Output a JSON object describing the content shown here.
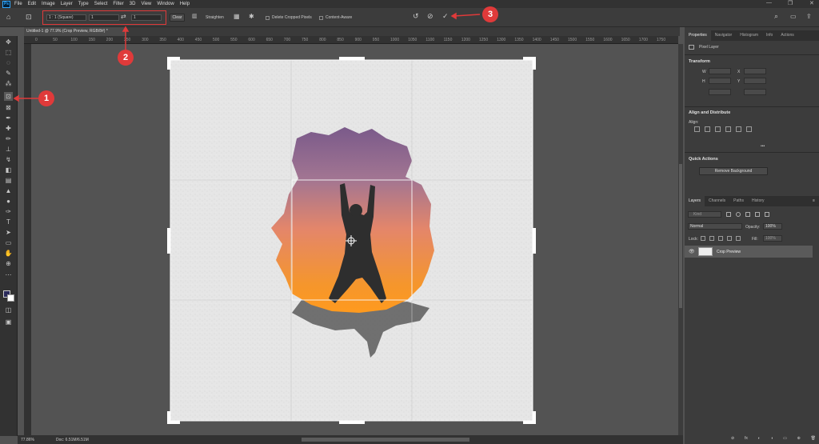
{
  "menubar": {
    "logo": "Ps",
    "items": [
      "File",
      "Edit",
      "Image",
      "Layer",
      "Type",
      "Select",
      "Filter",
      "3D",
      "View",
      "Window",
      "Help"
    ],
    "win_controls": [
      "—",
      "❐",
      "✕"
    ]
  },
  "options": {
    "ratio": "1 : 1 (Square)",
    "width": "1",
    "height": "1",
    "clear_label": "Clear",
    "straighten_label": "Straighten",
    "delete_label": "Delete Cropped Pixels",
    "content_aware_label": "Content-Aware"
  },
  "document": {
    "tab_title": "Untitled-1 @ 77.9% (Crop Preview, RGB/8#) *"
  },
  "ruler": {
    "ticks": [
      "0",
      "50",
      "100",
      "150",
      "200",
      "250",
      "300",
      "350",
      "400",
      "450",
      "500",
      "550",
      "600",
      "650",
      "700",
      "750",
      "800",
      "850",
      "900",
      "950",
      "1000",
      "1050",
      "1100",
      "1150",
      "1200",
      "1250",
      "1300",
      "1350",
      "1400",
      "1450",
      "1500",
      "1550",
      "1600",
      "1650",
      "1700",
      "1750"
    ]
  },
  "status": {
    "zoom": "77.86%",
    "doc": "Doc: 6.51M/6.51M"
  },
  "annotations": [
    "1",
    "2",
    "3"
  ],
  "panels": {
    "top_tabs": [
      "Properties",
      "Navigator",
      "Histogram",
      "Info",
      "Actions"
    ],
    "pixel_layer": "Pixel Layer",
    "transform": "Transform",
    "tf_labels": [
      "W",
      "H",
      "X",
      "Y"
    ],
    "align_title": "Align and Distribute",
    "align_label": "Align:",
    "quick_actions": "Quick Actions",
    "remove_bg": "Remove Background",
    "layer_tabs": [
      "Layers",
      "Channels",
      "Paths",
      "History"
    ],
    "kind": "Kind",
    "blend": "Normal",
    "opacity_label": "Opacity:",
    "opacity": "100%",
    "lock_label": "Lock:",
    "fill_label": "Fill:",
    "fill": "100%",
    "layer_name": "Crop Preview",
    "more": "•••",
    "menu": "≡",
    "bottom_icons": [
      "⊘",
      "fx",
      "◐",
      "◑",
      "▭",
      "⊕",
      "🗑"
    ]
  },
  "colors": {
    "accent": "#e03a3a",
    "canvas_bg": "#535353",
    "panel_bg": "#3c3c3c"
  }
}
